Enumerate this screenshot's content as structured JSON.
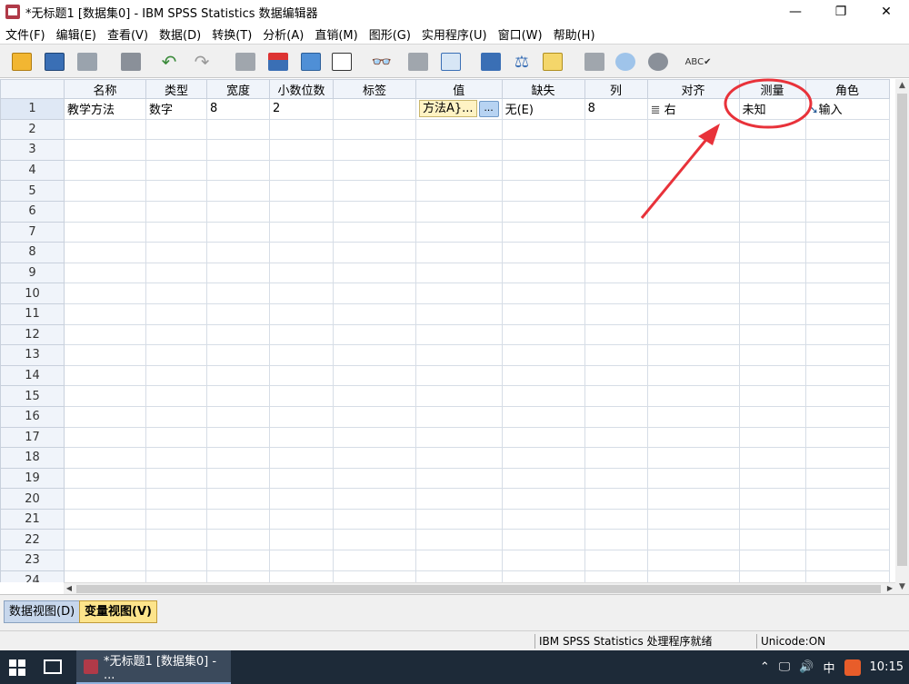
{
  "window": {
    "title": "*无标题1 [数据集0] - IBM SPSS Statistics 数据编辑器"
  },
  "menu": [
    "文件(F)",
    "编辑(E)",
    "查看(V)",
    "数据(D)",
    "转换(T)",
    "分析(A)",
    "直销(M)",
    "图形(G)",
    "实用程序(U)",
    "窗口(W)",
    "帮助(H)"
  ],
  "toolbar_icons": [
    "open-icon",
    "save-icon",
    "print-icon",
    "recall-dialog-icon",
    "undo-icon",
    "redo-icon",
    "goto-case-icon",
    "goto-variable-icon",
    "variables-icon",
    "run-descriptives-icon",
    "find-icon",
    "insert-cases-icon",
    "insert-variable-icon",
    "split-file-icon",
    "weight-cases-icon",
    "select-cases-icon",
    "value-labels-icon",
    "use-variable-sets-icon",
    "show-all-variables-icon",
    "spell-check-icon"
  ],
  "grid": {
    "columns": [
      "名称",
      "类型",
      "宽度",
      "小数位数",
      "标签",
      "值",
      "缺失",
      "列",
      "对齐",
      "测量",
      "角色"
    ],
    "row1": {
      "name": "教学方法",
      "type": "数字",
      "width": "8",
      "decimals": "2",
      "label": "",
      "values": "方法A}...",
      "values_button": "...",
      "missing": "无(E)",
      "columns": "8",
      "align": "右",
      "measure": "未知",
      "role": "输入"
    },
    "row_numbers": [
      "1",
      "2",
      "3",
      "4",
      "5",
      "6",
      "7",
      "8",
      "9",
      "10",
      "11",
      "12",
      "13",
      "14",
      "15",
      "16",
      "17",
      "18",
      "19",
      "20",
      "21",
      "22",
      "23",
      "24"
    ]
  },
  "tabs": {
    "data_view": "数据视图(D)",
    "variable_view": "变量视图(V)"
  },
  "status": {
    "processor": "IBM SPSS Statistics 处理程序就绪",
    "unicode": "Unicode:ON"
  },
  "taskbar": {
    "app_label": "*无标题1 [数据集0] - ...",
    "ime": "中",
    "clock": "10:15"
  },
  "colors": {
    "annotation": "#e8323a",
    "active_tab": "#fde48b",
    "header_bg": "#f0f4fa"
  }
}
